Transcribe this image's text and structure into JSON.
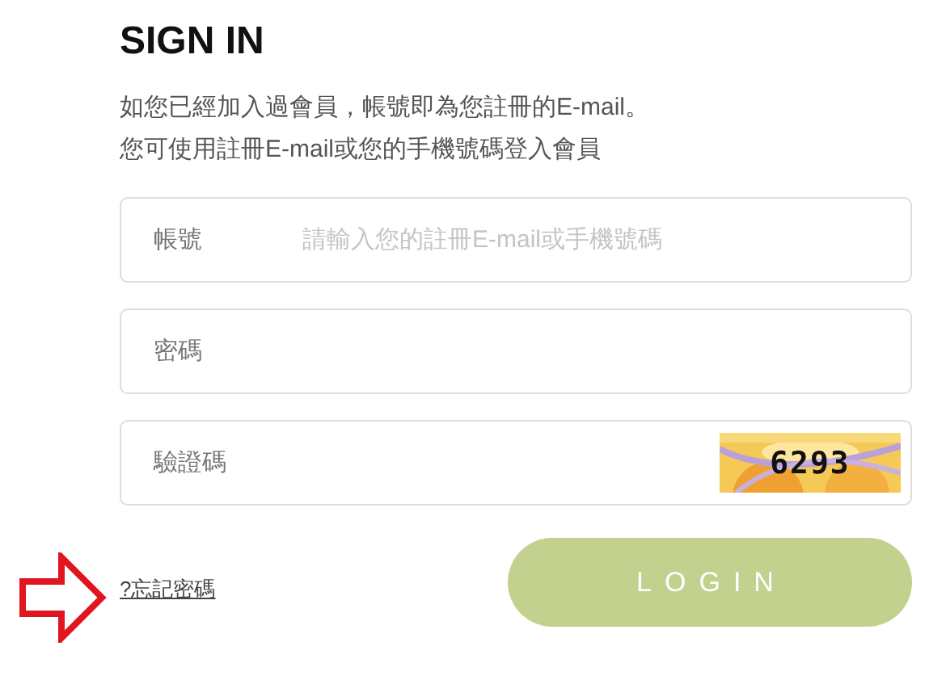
{
  "title": "SIGN IN",
  "intro": [
    "如您已經加入過會員，帳號即為您註冊的E-mail。",
    "您可使用註冊E-mail或您的手機號碼登入會員"
  ],
  "fields": [
    {
      "kind": "text",
      "label": "帳號",
      "placeholder": "請輸入您的註冊E-mail或手機號碼"
    },
    {
      "kind": "password",
      "label": "密碼"
    },
    {
      "kind": "captcha",
      "label": "驗證碼",
      "captcha": "6293"
    }
  ],
  "forgot_link": "?忘記密碼",
  "login_button": "LOGIN"
}
